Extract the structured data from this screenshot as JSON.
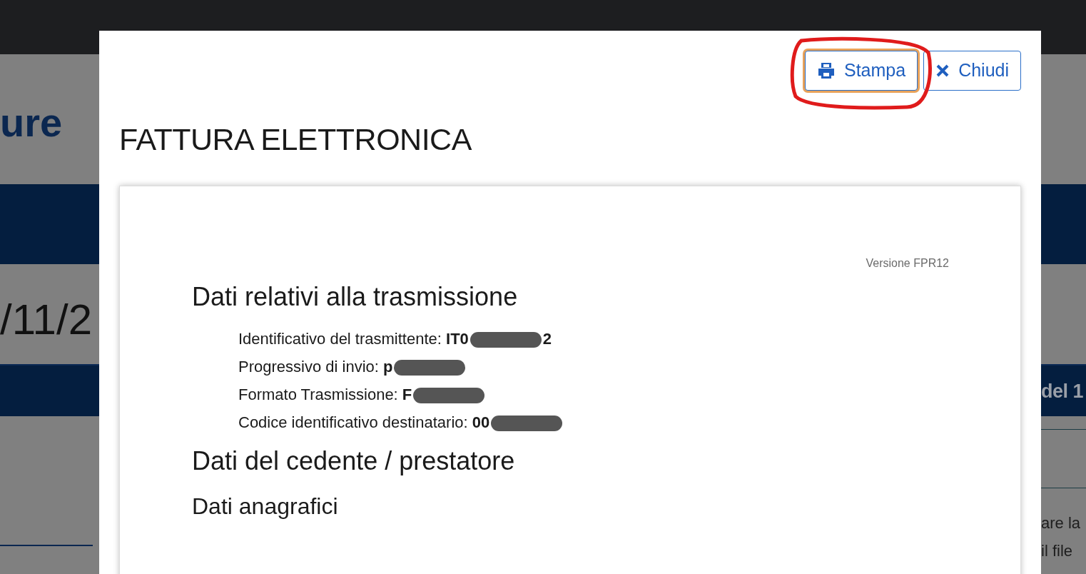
{
  "background_page": {
    "title_fragment": "ure",
    "date_fragment": "/11/2",
    "band_text": "del 1",
    "text_lines": [
      "are la",
      "il file"
    ]
  },
  "modal": {
    "buttons": [
      {
        "kind": "print",
        "label": "Stampa",
        "focused": true,
        "highlighted": true
      },
      {
        "kind": "close",
        "label": "Chiudi",
        "focused": false,
        "highlighted": false
      }
    ],
    "title": "FATTURA ELETTRONICA",
    "document": {
      "version": "Versione FPR12",
      "sections": [
        {
          "kind": "h1",
          "title": "Dati relativi alla trasmissione",
          "fields": [
            {
              "label": "Identificativo del trasmittente:",
              "value": "IT0",
              "value_end": "2",
              "redacted": true
            },
            {
              "label": "Progressivo di invio:",
              "value": "p",
              "redacted": true
            },
            {
              "label": "Formato Trasmissione:",
              "value": "F",
              "redacted": true
            },
            {
              "label": "Codice identificativo destinatario:",
              "value": "00",
              "redacted": true
            }
          ]
        },
        {
          "kind": "h1",
          "title": "Dati del cedente / prestatore"
        },
        {
          "kind": "h2",
          "title": "Dati anagrafici"
        }
      ]
    }
  }
}
